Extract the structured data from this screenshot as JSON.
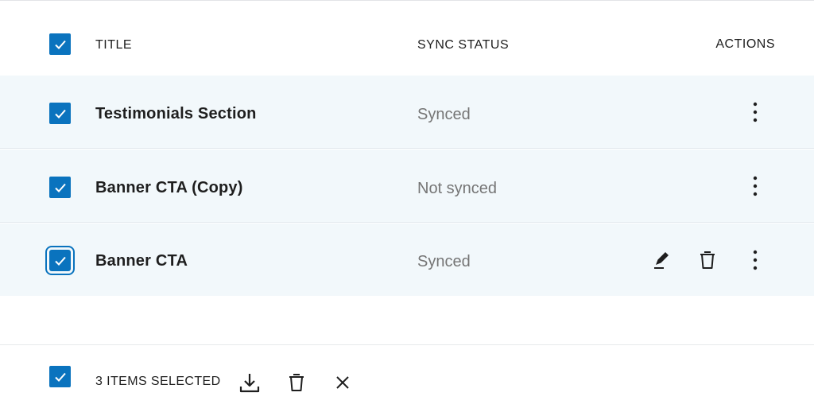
{
  "table": {
    "headers": {
      "title": "TITLE",
      "sync_status": "SYNC STATUS",
      "actions": "ACTIONS"
    },
    "select_all_checked": true,
    "rows": [
      {
        "title": "Testimonials Section",
        "sync_status": "Synced",
        "checked": true,
        "show_inline_actions": false
      },
      {
        "title": "Banner CTA (Copy)",
        "sync_status": "Not synced",
        "checked": true,
        "show_inline_actions": false
      },
      {
        "title": "Banner CTA",
        "sync_status": "Synced",
        "checked": true,
        "show_inline_actions": true,
        "focused": true
      }
    ]
  },
  "bulk_bar": {
    "selected_label": "3 ITEMS SELECTED",
    "icons": [
      "download-icon",
      "trash-icon",
      "close-icon"
    ]
  },
  "colors": {
    "accent": "#0a73be",
    "row_highlight": "#f2f8fb",
    "muted_text": "#757575",
    "text": "#1e1e1e"
  }
}
